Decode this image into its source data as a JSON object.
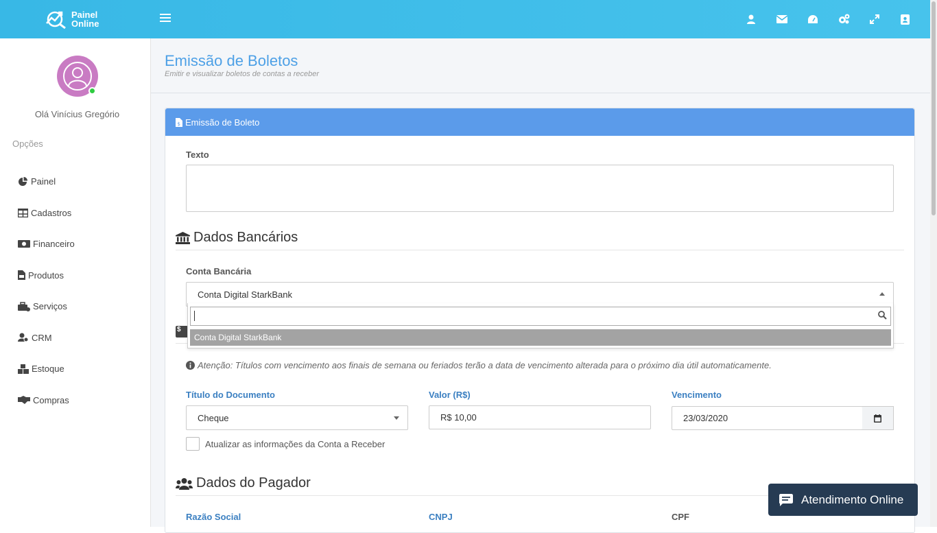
{
  "app": {
    "logo_line1": "Painel",
    "logo_line2": "Online"
  },
  "topbar": {
    "icons": [
      "user-icon",
      "envelope-icon",
      "dashboard-icon",
      "cogs-icon",
      "expand-icon",
      "address-book-icon"
    ]
  },
  "sidebar": {
    "greeting": "Olá Vinícius Gregório",
    "menu_header": "Opções",
    "items": [
      {
        "label": "Painel",
        "icon": "pie-chart-icon"
      },
      {
        "label": "Cadastros",
        "icon": "table-icon"
      },
      {
        "label": "Financeiro",
        "icon": "money-icon"
      },
      {
        "label": "Produtos",
        "icon": "file-invoice-icon"
      },
      {
        "label": "Serviços",
        "icon": "toolbox-icon"
      },
      {
        "label": "CRM",
        "icon": "users-cog-icon"
      },
      {
        "label": "Estoque",
        "icon": "boxes-icon"
      },
      {
        "label": "Compras",
        "icon": "handshake-icon"
      }
    ]
  },
  "page": {
    "title": "Emissão de Boletos",
    "subtitle": "Emitir e visualizar boletos de contas a receber"
  },
  "panel": {
    "title": "Emissão de Boleto",
    "texto_label": "Texto",
    "texto_value": "",
    "section_bank": "Dados Bancários",
    "conta_label": "Conta Bancária",
    "conta_value": "Conta Digital StarkBank",
    "dropdown_search": "",
    "dropdown_option": "Conta Digital StarkBank",
    "hidden_icon_text": "$",
    "attention": "Atenção: Títulos com vencimento aos finais de semana ou feriados terão a data de vencimento alterada para o próximo dia útil automaticamente.",
    "titulo_label": "Título do Documento",
    "titulo_value": "Cheque",
    "valor_label": "Valor (R$)",
    "valor_value": "R$ 10,00",
    "vencimento_label": "Vencimento",
    "vencimento_value": "23/03/2020",
    "checkbox_label": "Atualizar as informações da Conta a Receber",
    "section_pagador": "Dados do Pagador",
    "razao_label": "Razão Social",
    "cnpj_label": "CNPJ",
    "cpf_label": "CPF"
  },
  "chat": {
    "label": "Atendimento Online"
  }
}
